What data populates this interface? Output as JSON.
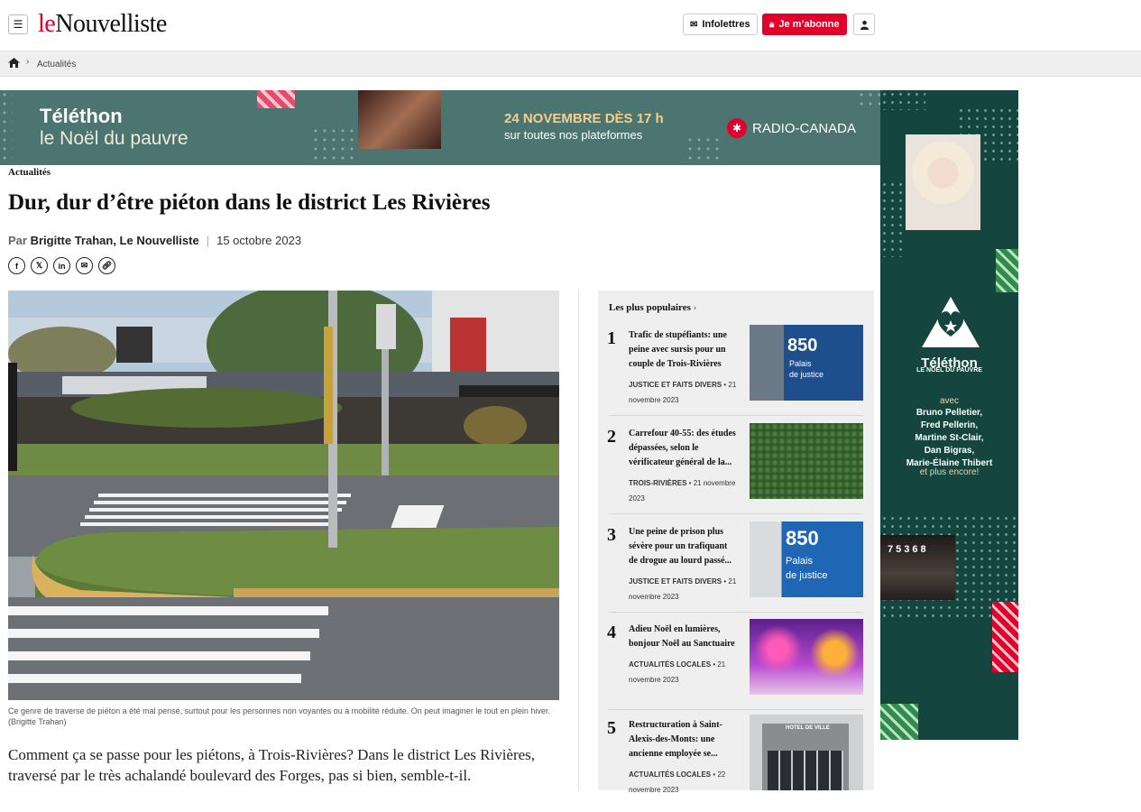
{
  "header": {
    "logo_le": "le",
    "logo_name": "Nouvelliste",
    "newsletter_label": "Infolettres",
    "subscribe_label": "Je m’abonne"
  },
  "breadcrumb": {
    "section": "Actualités"
  },
  "top_ad": {
    "title": "Téléthon",
    "subtitle": "le Noël du pauvre",
    "date": "24 NOVEMBRE DÈS 17 h",
    "platforms": "sur toutes nos plateformes",
    "network": "RADIO-CANADA"
  },
  "article": {
    "section": "Actualités",
    "title": "Dur, dur d’être piéton dans le district Les Rivières",
    "by_prefix": "Par",
    "author": "Brigitte Trahan, Le Nouvelliste",
    "date": "15 octobre 2023",
    "caption": "Ce genre de traverse de piéton a été mal pensé, surtout pour les personnes non voyantes ou à mobilité réduite. On peut imaginer le tout en plein hiver.",
    "caption_credit": "(Brigitte Trahan)",
    "lede": "Comment ça se passe pour les piétons, à Trois-Rivières? Dans le district Les Rivières, traversé par le très achalandé boulevard des Forges, pas si bien, semble-t-il."
  },
  "popular": {
    "heading": "Les plus populaires",
    "items": [
      {
        "num": "1",
        "title": "Trafic de stupéfiants: une peine avec sursis pour un couple de Trois-Rivières",
        "category": "JUSTICE ET FAITS DIVERS",
        "date": "21 novembre 2023"
      },
      {
        "num": "2",
        "title": "Carrefour 40-55: des études dépassées, selon le vérificateur général de la...",
        "category": "TROIS-RIVIÈRES",
        "date": "21 novembre 2023"
      },
      {
        "num": "3",
        "title": "Une peine de prison plus sévère pour un trafiquant de drogue au lourd passé...",
        "category": "JUSTICE ET FAITS DIVERS",
        "date": "21 novembre 2023"
      },
      {
        "num": "4",
        "title": "Adieu Noël en lumières, bonjour Noël au Sanctuaire",
        "category": "ACTUALITÉS LOCALES",
        "date": "21 novembre 2023"
      },
      {
        "num": "5",
        "title": "Restructuration à Saint-Alexis-des-Monts: une ancienne employée se...",
        "category": "ACTUALITÉS LOCALES",
        "date": "22 novembre 2023"
      }
    ],
    "thumb_text": {
      "sign_number": "850",
      "sign_line1": "Palais",
      "sign_line2": "de justice",
      "hotel": "HOTEL DE VILLE"
    }
  },
  "side_ad": {
    "title": "Téléthon",
    "subtitle": "LE NOËL DU PAUVRE",
    "avec": "avec",
    "names": [
      "Bruno Pelletier,",
      "Fred Pellerin,",
      "Martine St-Clair,",
      "Dan Bigras,",
      "Marie-Élaine Thibert"
    ],
    "more": "et plus encore!",
    "board_number": "75368"
  },
  "colors": {
    "brand_red": "#e0002a",
    "ad_teal": "#4c7470",
    "ad_dark_green": "#15453f"
  }
}
